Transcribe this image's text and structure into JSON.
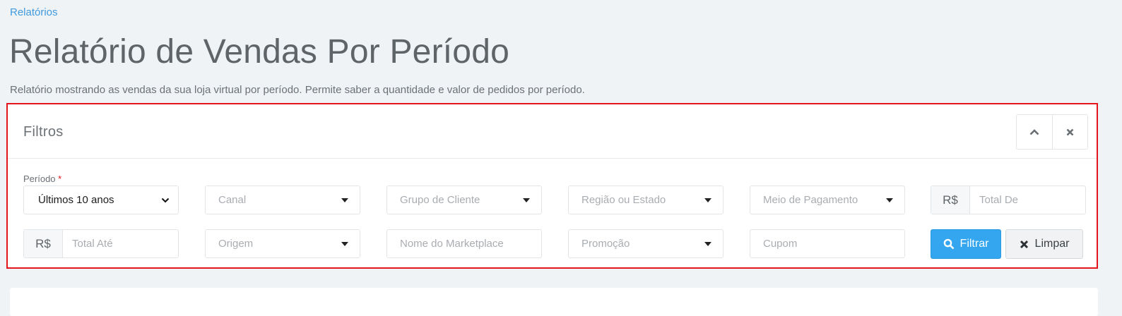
{
  "breadcrumb": "Relatórios",
  "page": {
    "title": "Relatório de Vendas Por Período",
    "description": "Relatório mostrando as vendas da sua loja virtual por período. Permite saber a quantidade e valor de pedidos por período."
  },
  "filters": {
    "title": "Filtros",
    "periodo_label": "Período",
    "required_mark": "*",
    "periodo_value": "Últimos 10 anos",
    "canal": "Canal",
    "grupo_cliente": "Grupo de Cliente",
    "regiao": "Região ou Estado",
    "meio_pagamento": "Meio de Pagamento",
    "currency": "R$",
    "total_de": "Total De",
    "total_ate": "Total Até",
    "origem": "Origem",
    "marketplace": "Nome do Marketplace",
    "promocao": "Promoção",
    "cupom": "Cupom",
    "btn_filtrar": "Filtrar",
    "btn_limpar": "Limpar"
  },
  "colors": {
    "accent": "#33a6ef",
    "highlight_border": "#e3141b"
  }
}
